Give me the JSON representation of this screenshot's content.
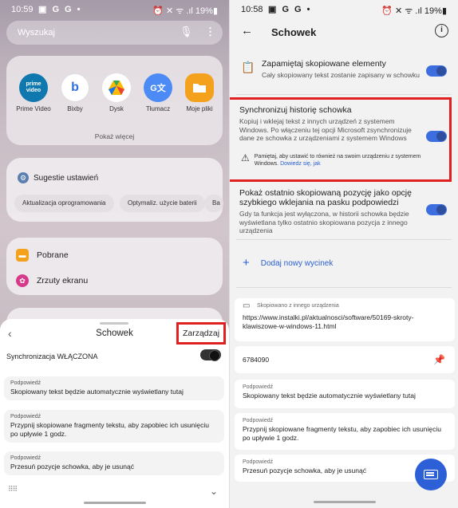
{
  "left": {
    "status": {
      "time": "10:59",
      "icons": "▣ G G •",
      "right": "⏰ ✕ ᯤ .ıl 19%▮"
    },
    "search": {
      "placeholder": "Wyszukaj"
    },
    "apps": [
      {
        "label": "Prime Video",
        "icon": "prime-video-icon",
        "glyph": "prime video",
        "color": "#0f79af"
      },
      {
        "label": "Bixby",
        "icon": "bixby-icon",
        "glyph": "b",
        "color": "#ffffff"
      },
      {
        "label": "Dysk",
        "icon": "drive-icon",
        "glyph": "▲",
        "color": "#ffffff"
      },
      {
        "label": "Tłumacz",
        "icon": "translate-icon",
        "glyph": "G文",
        "color": "#4c8bf5"
      },
      {
        "label": "Moje pliki",
        "icon": "folder-icon",
        "glyph": "▬",
        "color": "#f4a21d"
      }
    ],
    "show_more": "Pokaż więcej",
    "suggestions": {
      "title": "Sugestie ustawień",
      "chips": [
        "Aktualizacja oprogramowania",
        "Optymaliz. użycie baterii",
        "Ba"
      ]
    },
    "files": [
      {
        "label": "Pobrane",
        "icon": "download-folder-icon",
        "color": "#f4a21d"
      },
      {
        "label": "Zrzuty ekranu",
        "icon": "screenshot-folder-icon",
        "color": "#d63a8a"
      }
    ],
    "clipboard": {
      "title": "Schowek",
      "manage": "Zarządzaj",
      "sync": "Synchronizacja WŁĄCZONA",
      "tips": [
        {
          "header": "Podpowiedź",
          "text": "Skopiowany tekst będzie automatycznie wyświetlany tutaj"
        },
        {
          "header": "Podpowiedź",
          "text": "Przypnij skopiowane fragmenty tekstu, aby zapobiec ich usunięciu po upływie 1 godz."
        },
        {
          "header": "Podpowiedź",
          "text": "Przesuń pozycje schowka, aby je usunąć"
        }
      ]
    }
  },
  "right": {
    "status": {
      "time": "10:58",
      "icons": "▣ G G •",
      "right": "⏰ ✕ ᯤ .ıl 19%▮"
    },
    "title": "Schowek",
    "settings": [
      {
        "title": "Zapamiętaj skopiowane elementy",
        "desc": "Cały skopiowany tekst zostanie zapisany w schowku"
      },
      {
        "title": "Synchronizuj historię schowka",
        "desc": "Kopiuj i wklejaj tekst z innych urządzeń z systemem Windows. Po włączeniu tej opcji Microsoft zsynchronizuje dane ze schowka z urządzeniami z systemem Windows"
      },
      {
        "title": "Pokaż ostatnio skopiowaną pozycję jako opcję szybkiego wklejania na pasku podpowiedzi",
        "desc": "Gdy ta funkcja jest wyłączona, w historii schowka będzie wyświetlana tylko ostatnio skopiowana pozycja z innego urządzenia"
      }
    ],
    "warning": {
      "text": "Pamiętaj, aby ustawić to również na swoim urządzeniu z systemem Windows.",
      "link": "Dowiedz się, jak"
    },
    "add_clip": "Dodaj nowy wycinek",
    "clips": [
      {
        "header": "Skopiowano z innego urządzenia",
        "text": "https://www.instalki.pl/aktualnosci/software/50169-skroty-klawiszowe-w-windows-11.html"
      },
      {
        "header": "",
        "text": "6784090"
      },
      {
        "header": "Podpowiedź",
        "text": "Skopiowany tekst będzie automatycznie wyświetlany tutaj"
      },
      {
        "header": "Podpowiedź",
        "text": "Przypnij skopiowane fragmenty tekstu, aby zapobiec ich usunięciu po upływie 1 godz."
      },
      {
        "header": "Podpowiedź",
        "text": "Przesuń pozycje schowka, aby je usunąć"
      }
    ],
    "accent": "#2d5fd6",
    "highlight": "#e02020"
  }
}
